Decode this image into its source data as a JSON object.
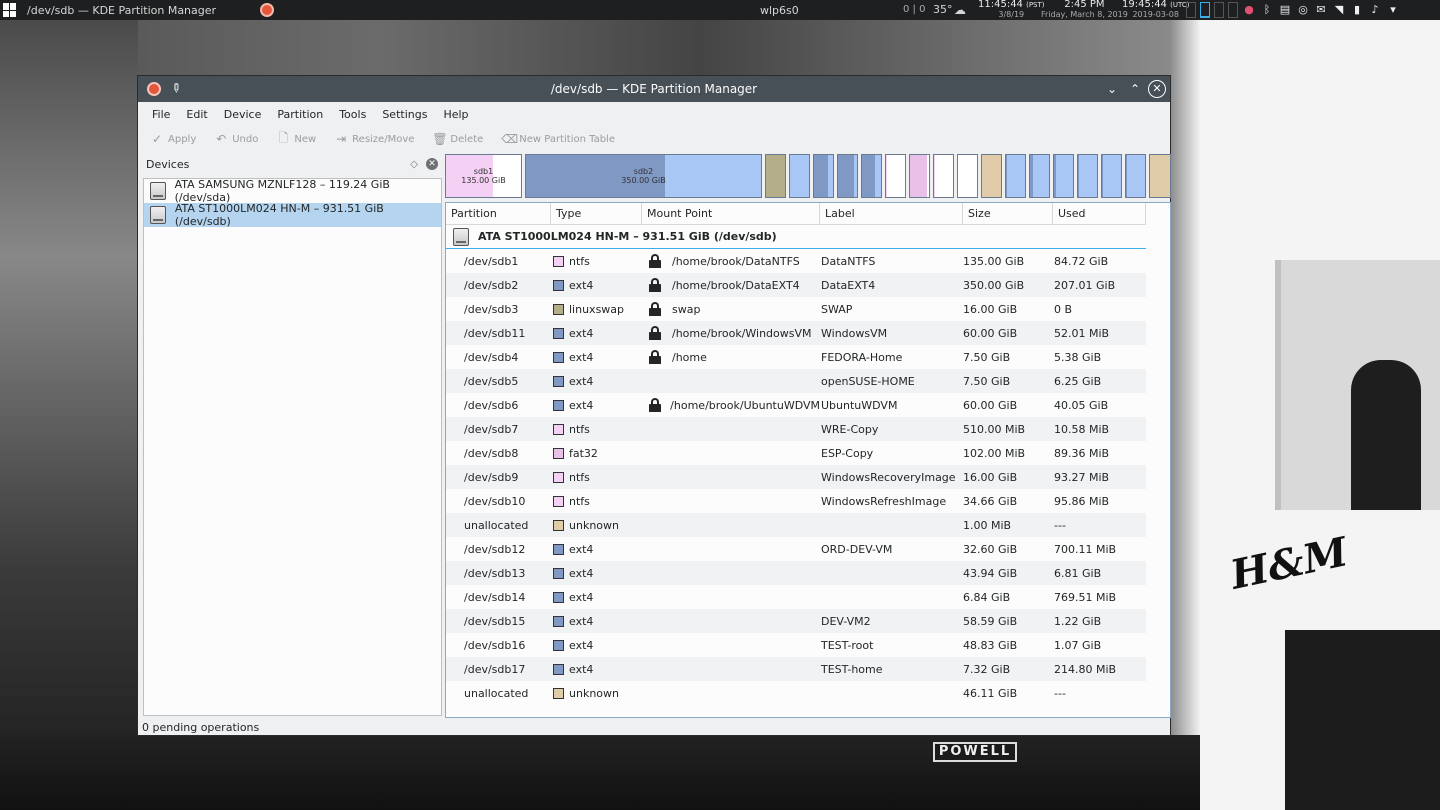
{
  "panel": {
    "task_title": "/dev/sdb — KDE Partition Manager",
    "hostname": "wlp6s0",
    "load": "0 | 0",
    "temperature": "35°",
    "clock1": {
      "time": "11:45:44",
      "zone": "(PST)",
      "date": "3/8/19"
    },
    "clock2": {
      "time": "2:45 PM",
      "date": "Friday, March 8, 2019"
    },
    "clock3": {
      "time": "19:45:44",
      "zone": "(UTC)",
      "date": "2019-03-08"
    }
  },
  "window": {
    "title": "/dev/sdb — KDE Partition Manager",
    "menu": [
      "File",
      "Edit",
      "Device",
      "Partition",
      "Tools",
      "Settings",
      "Help"
    ],
    "toolbar": [
      {
        "label": "Apply",
        "icon": "check-icon"
      },
      {
        "label": "Undo",
        "icon": "undo-icon"
      },
      {
        "label": "New",
        "icon": "new-icon"
      },
      {
        "label": "Resize/Move",
        "icon": "resize-icon"
      },
      {
        "label": "Delete",
        "icon": "trash-icon"
      },
      {
        "label": "New Partition Table",
        "icon": "clear-icon"
      }
    ],
    "devices_header": "Devices",
    "devices": [
      {
        "label": "ATA SAMSUNG MZNLF128 – 119.24 GiB (/dev/sda)",
        "selected": false
      },
      {
        "label": "ATA ST1000LM024 HN-M – 931.51 GiB (/dev/sdb)",
        "selected": true
      }
    ],
    "partition_bar": [
      {
        "name": "sdb1",
        "size": "135.00 GiB"
      },
      {
        "name": "sdb2",
        "size": "350.00 GiB"
      }
    ],
    "columns": [
      "Partition",
      "Type",
      "Mount Point",
      "Label",
      "Size",
      "Used"
    ],
    "device_row": "ATA ST1000LM024 HN-M – 931.51 GiB (/dev/sdb)",
    "partitions": [
      {
        "partition": "/dev/sdb1",
        "type": "ntfs",
        "color": "#f4d0f4",
        "locked": true,
        "mount": "/home/brook/DataNTFS",
        "label": "DataNTFS",
        "size": "135.00 GiB",
        "used": "84.72 GiB"
      },
      {
        "partition": "/dev/sdb2",
        "type": "ext4",
        "color": "#7f98c4",
        "locked": true,
        "mount": "/home/brook/DataEXT4",
        "label": "DataEXT4",
        "size": "350.00 GiB",
        "used": "207.01 GiB"
      },
      {
        "partition": "/dev/sdb3",
        "type": "linuxswap",
        "color": "#b5ae8a",
        "locked": true,
        "mount": "swap",
        "label": "SWAP",
        "size": "16.00 GiB",
        "used": "0 B"
      },
      {
        "partition": "/dev/sdb11",
        "type": "ext4",
        "color": "#7f98c4",
        "locked": true,
        "mount": "/home/brook/WindowsVM",
        "label": "WindowsVM",
        "size": "60.00 GiB",
        "used": "52.01 MiB"
      },
      {
        "partition": "/dev/sdb4",
        "type": "ext4",
        "color": "#7f98c4",
        "locked": true,
        "mount": "/home",
        "label": "FEDORA-Home",
        "size": "7.50 GiB",
        "used": "5.38 GiB"
      },
      {
        "partition": "/dev/sdb5",
        "type": "ext4",
        "color": "#7f98c4",
        "locked": false,
        "mount": "",
        "label": "openSUSE-HOME",
        "size": "7.50 GiB",
        "used": "6.25 GiB"
      },
      {
        "partition": "/dev/sdb6",
        "type": "ext4",
        "color": "#7f98c4",
        "locked": true,
        "mount": "/home/brook/UbuntuWDVM",
        "label": "UbuntuWDVM",
        "size": "60.00 GiB",
        "used": "40.05 GiB"
      },
      {
        "partition": "/dev/sdb7",
        "type": "ntfs",
        "color": "#f4d0f4",
        "locked": false,
        "mount": "",
        "label": "WRE-Copy",
        "size": "510.00 MiB",
        "used": "10.58 MiB"
      },
      {
        "partition": "/dev/sdb8",
        "type": "fat32",
        "color": "#e8c0e8",
        "locked": false,
        "mount": "",
        "label": "ESP-Copy",
        "size": "102.00 MiB",
        "used": "89.36 MiB"
      },
      {
        "partition": "/dev/sdb9",
        "type": "ntfs",
        "color": "#f4d0f4",
        "locked": false,
        "mount": "",
        "label": "WindowsRecoveryImage",
        "size": "16.00 GiB",
        "used": "93.27 MiB"
      },
      {
        "partition": "/dev/sdb10",
        "type": "ntfs",
        "color": "#f4d0f4",
        "locked": false,
        "mount": "",
        "label": "WindowsRefreshImage",
        "size": "34.66 GiB",
        "used": "95.86 MiB"
      },
      {
        "partition": "unallocated",
        "type": "unknown",
        "color": "#e0cca8",
        "locked": false,
        "mount": "",
        "label": "",
        "size": "1.00 MiB",
        "used": "---"
      },
      {
        "partition": "/dev/sdb12",
        "type": "ext4",
        "color": "#7f98c4",
        "locked": false,
        "mount": "",
        "label": "ORD-DEV-VM",
        "size": "32.60 GiB",
        "used": "700.11 MiB"
      },
      {
        "partition": "/dev/sdb13",
        "type": "ext4",
        "color": "#7f98c4",
        "locked": false,
        "mount": "",
        "label": "",
        "size": "43.94 GiB",
        "used": "6.81 GiB"
      },
      {
        "partition": "/dev/sdb14",
        "type": "ext4",
        "color": "#7f98c4",
        "locked": false,
        "mount": "",
        "label": "",
        "size": "6.84 GiB",
        "used": "769.51 MiB"
      },
      {
        "partition": "/dev/sdb15",
        "type": "ext4",
        "color": "#7f98c4",
        "locked": false,
        "mount": "",
        "label": "DEV-VM2",
        "size": "58.59 GiB",
        "used": "1.22 GiB"
      },
      {
        "partition": "/dev/sdb16",
        "type": "ext4",
        "color": "#7f98c4",
        "locked": false,
        "mount": "",
        "label": "TEST-root",
        "size": "48.83 GiB",
        "used": "1.07 GiB"
      },
      {
        "partition": "/dev/sdb17",
        "type": "ext4",
        "color": "#7f98c4",
        "locked": false,
        "mount": "",
        "label": "TEST-home",
        "size": "7.32 GiB",
        "used": "214.80 MiB"
      },
      {
        "partition": "unallocated",
        "type": "unknown",
        "color": "#e0cca8",
        "locked": false,
        "mount": "",
        "label": "",
        "size": "46.11 GiB",
        "used": "---"
      }
    ],
    "status": "0 pending operations"
  },
  "desktop": {
    "street_sign": "POWELL",
    "store_sign": "H&M"
  }
}
